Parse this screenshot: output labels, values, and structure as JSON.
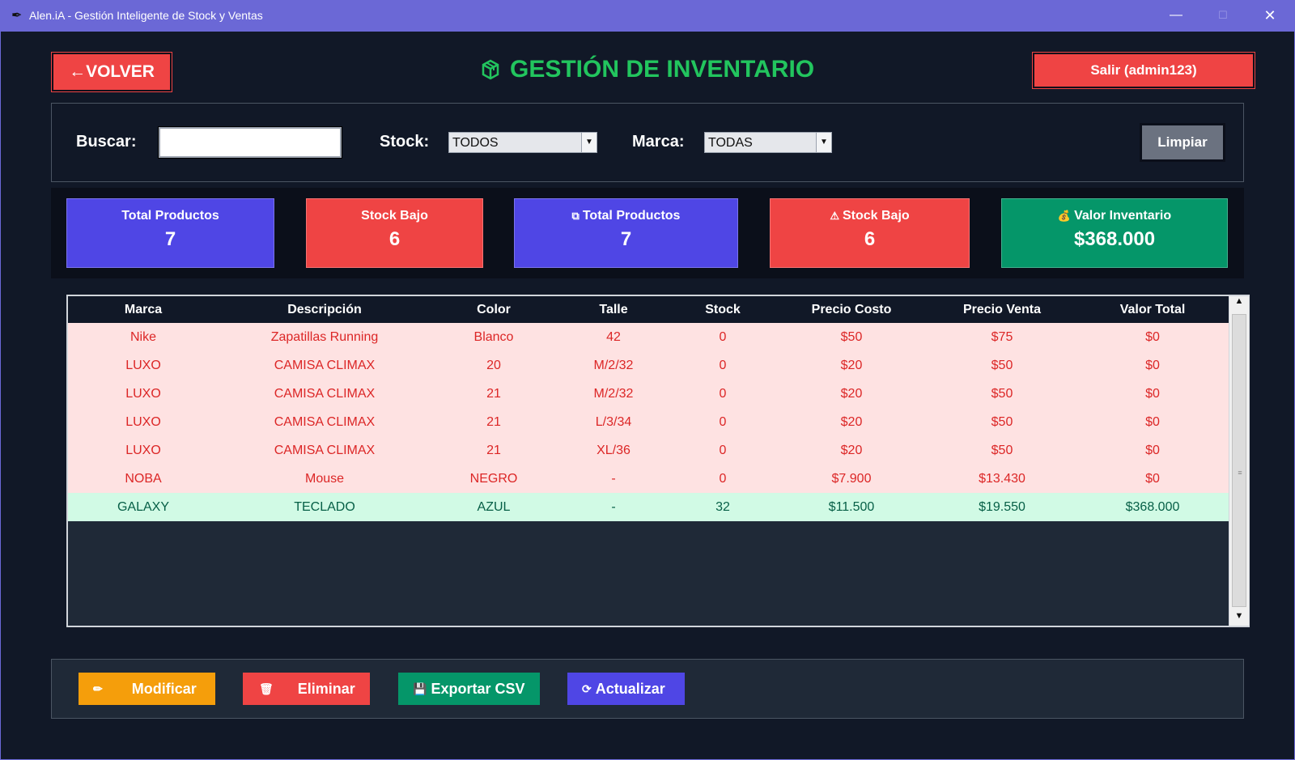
{
  "window": {
    "title": "Alen.iA - Gestión Inteligente de Stock y Ventas",
    "icon": "feather-icon"
  },
  "header": {
    "back_label": "←VOLVER",
    "title": "GESTIÓN DE INVENTARIO",
    "title_icon": "package-icon",
    "logout_label": "Salir (admin123)"
  },
  "filters": {
    "search_label": "Buscar:",
    "search_value": "",
    "stock_label": "Stock:",
    "stock_value": "TODOS",
    "brand_label": "Marca:",
    "brand_value": "TODAS",
    "clear_label": "Limpiar"
  },
  "stats": [
    {
      "label": "Total Productos",
      "value": "7",
      "icon": "",
      "color": "#4F46E5"
    },
    {
      "label": "Stock Bajo",
      "value": "6",
      "icon": "",
      "color": "#EF4444"
    },
    {
      "label": "Total Productos",
      "value": "7",
      "icon": "box-icon",
      "color": "#4F46E5"
    },
    {
      "label": "Stock Bajo",
      "value": "6",
      "icon": "warning-icon",
      "color": "#EF4444"
    },
    {
      "label": "Valor Inventario",
      "value": "$368.000",
      "icon": "money-bag-icon",
      "color": "#059669"
    }
  ],
  "table": {
    "columns": [
      "Marca",
      "Descripción",
      "Color",
      "Talle",
      "Stock",
      "Precio Costo",
      "Precio Venta",
      "Valor Total"
    ],
    "rows": [
      {
        "status": "low",
        "cells": [
          "Nike",
          "Zapatillas Running",
          "Blanco",
          "42",
          "0",
          "$50",
          "$75",
          "$0"
        ]
      },
      {
        "status": "low",
        "cells": [
          "LUXO",
          "CAMISA CLIMAX",
          "20",
          "M/2/32",
          "0",
          "$20",
          "$50",
          "$0"
        ]
      },
      {
        "status": "low",
        "cells": [
          "LUXO",
          "CAMISA CLIMAX",
          "21",
          "M/2/32",
          "0",
          "$20",
          "$50",
          "$0"
        ]
      },
      {
        "status": "low",
        "cells": [
          "LUXO",
          "CAMISA CLIMAX",
          "21",
          "L/3/34",
          "0",
          "$20",
          "$50",
          "$0"
        ]
      },
      {
        "status": "low",
        "cells": [
          "LUXO",
          "CAMISA CLIMAX",
          "21",
          "XL/36",
          "0",
          "$20",
          "$50",
          "$0"
        ]
      },
      {
        "status": "low",
        "cells": [
          "NOBA",
          "Mouse",
          "NEGRO",
          "-",
          "0",
          "$7.900",
          "$13.430",
          "$0"
        ]
      },
      {
        "status": "ok",
        "cells": [
          "GALAXY",
          "TECLADO",
          "AZUL",
          "-",
          "32",
          "$11.500",
          "$19.550",
          "$368.000"
        ]
      }
    ]
  },
  "actions": {
    "modify_label": "Modificar",
    "delete_label": "Eliminar",
    "export_label": "Exportar CSV",
    "refresh_label": "Actualizar"
  },
  "colors": {
    "background": "#111827",
    "accent_green": "#22C55E",
    "danger": "#EF4444",
    "primary": "#4F46E5",
    "success": "#059669",
    "warning": "#F59E0B",
    "low_row_bg": "#FEE2E2",
    "ok_row_bg": "#D1FAE5"
  }
}
